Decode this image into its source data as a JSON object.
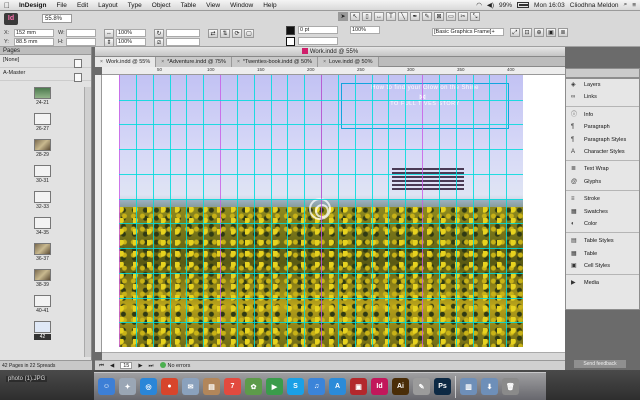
{
  "menubar": {
    "app": "InDesign",
    "items": [
      "File",
      "Edit",
      "Layout",
      "Type",
      "Object",
      "Table",
      "View",
      "Window",
      "Help"
    ],
    "battery": "99%",
    "clock": "Mon 16:03",
    "user": "Cliodhna Meldon"
  },
  "control": {
    "app_badge": "Id",
    "zoom": "55.8%",
    "x": "152 mm",
    "y": "88.5 mm",
    "w_label": "W:",
    "h_label": "H:",
    "x_label": "X:",
    "y_label": "Y:",
    "stroke_weight": "0 pt",
    "opacity": "100%",
    "percent": "100%",
    "frame_style": "[Basic Graphics Frame]+",
    "icons": [
      "selection-tool-icon",
      "direct-selection-icon",
      "page-tool-icon",
      "gap-tool-icon",
      "type-tool-icon",
      "line-tool-icon",
      "pen-tool-icon",
      "pencil-tool-icon",
      "rectangle-frame-icon",
      "rectangle-tool-icon",
      "scissors-icon",
      "transform-icon"
    ]
  },
  "document": {
    "title": "Work.indd @ 55%",
    "tabs": [
      {
        "label": "Work.indd @ 55%",
        "active": true
      },
      {
        "label": "*Adventure.indd @ 75%",
        "active": false
      },
      {
        "label": "*Twenties-book.indd @ 50%",
        "active": false
      },
      {
        "label": "Love.indd @ 50%",
        "active": false
      }
    ],
    "ruler_labels": [
      "50",
      "100",
      "150",
      "200",
      "250",
      "300",
      "350",
      "400"
    ],
    "headline": "How to find your Glow on the Shine",
    "subline": "TO FULL TIVES STORY"
  },
  "pages_panel": {
    "header": "Pages",
    "none_label": "[None]",
    "master_label": "A-Master",
    "spreads": [
      "24-21",
      "26-27",
      "28-29",
      "30-31",
      "32-33",
      "34-35",
      "36-37",
      "38-39",
      "40-41",
      "42"
    ],
    "footer": "42 Pages in 22 Spreads"
  },
  "status": {
    "page": "15",
    "errors": "No errors"
  },
  "right_panel": {
    "groups": [
      [
        {
          "label": "Layers",
          "icon": "layers-icon"
        },
        {
          "label": "Links",
          "icon": "links-icon"
        }
      ],
      [
        {
          "label": "Info",
          "icon": "info-icon"
        },
        {
          "label": "Paragraph",
          "icon": "paragraph-icon"
        },
        {
          "label": "Paragraph Styles",
          "icon": "paragraph-styles-icon"
        },
        {
          "label": "Character Styles",
          "icon": "character-styles-icon"
        }
      ],
      [
        {
          "label": "Text Wrap",
          "icon": "text-wrap-icon"
        },
        {
          "label": "Glyphs",
          "icon": "glyphs-icon"
        }
      ],
      [
        {
          "label": "Stroke",
          "icon": "stroke-icon"
        },
        {
          "label": "Swatches",
          "icon": "swatches-icon"
        },
        {
          "label": "Color",
          "icon": "color-icon"
        }
      ],
      [
        {
          "label": "Table Styles",
          "icon": "table-styles-icon"
        },
        {
          "label": "Table",
          "icon": "table-icon"
        },
        {
          "label": "Cell Styles",
          "icon": "cell-styles-icon"
        }
      ],
      [
        {
          "label": "Media",
          "icon": "media-icon"
        }
      ]
    ]
  },
  "feedback": "Send feedback",
  "desktop": {
    "file_label": "photo (1).JPG"
  },
  "dock": {
    "apps": [
      {
        "name": "finder",
        "glyph": "☺",
        "color": "#3d7fd6"
      },
      {
        "name": "launchpad",
        "glyph": "✦",
        "color": "#9aa6b5"
      },
      {
        "name": "safari",
        "glyph": "◎",
        "color": "#2a86d8"
      },
      {
        "name": "chrome",
        "glyph": "●",
        "color": "#d7452b"
      },
      {
        "name": "mail",
        "glyph": "✉",
        "color": "#8aa1bd"
      },
      {
        "name": "contacts",
        "glyph": "▤",
        "color": "#b2865a"
      },
      {
        "name": "calendar",
        "glyph": "7",
        "color": "#e24a3f"
      },
      {
        "name": "photos",
        "glyph": "✿",
        "color": "#5d9b4a"
      },
      {
        "name": "facetime",
        "glyph": "▶",
        "color": "#3a9c4b"
      },
      {
        "name": "skype",
        "glyph": "S",
        "color": "#1aa0e6"
      },
      {
        "name": "itunes",
        "glyph": "♫",
        "color": "#3b84d9"
      },
      {
        "name": "app-store",
        "glyph": "A",
        "color": "#2b8bd9"
      },
      {
        "name": "photo-booth",
        "glyph": "▣",
        "color": "#b3282c"
      },
      {
        "name": "indesign",
        "glyph": "Id",
        "color": "#c2175b"
      },
      {
        "name": "illustrator",
        "glyph": "Ai",
        "color": "#4a2d08"
      },
      {
        "name": "acrobat",
        "glyph": "✎",
        "color": "#9b9b9b"
      },
      {
        "name": "photoshop",
        "glyph": "Ps",
        "color": "#0d2944"
      }
    ],
    "right_items": [
      {
        "name": "applications-folder",
        "glyph": "▥",
        "color": "#6e8fb8"
      },
      {
        "name": "downloads-folder",
        "glyph": "⬇",
        "color": "#6e8fb8"
      },
      {
        "name": "trash",
        "glyph": "🗑",
        "color": "#8a8a8a"
      }
    ]
  }
}
